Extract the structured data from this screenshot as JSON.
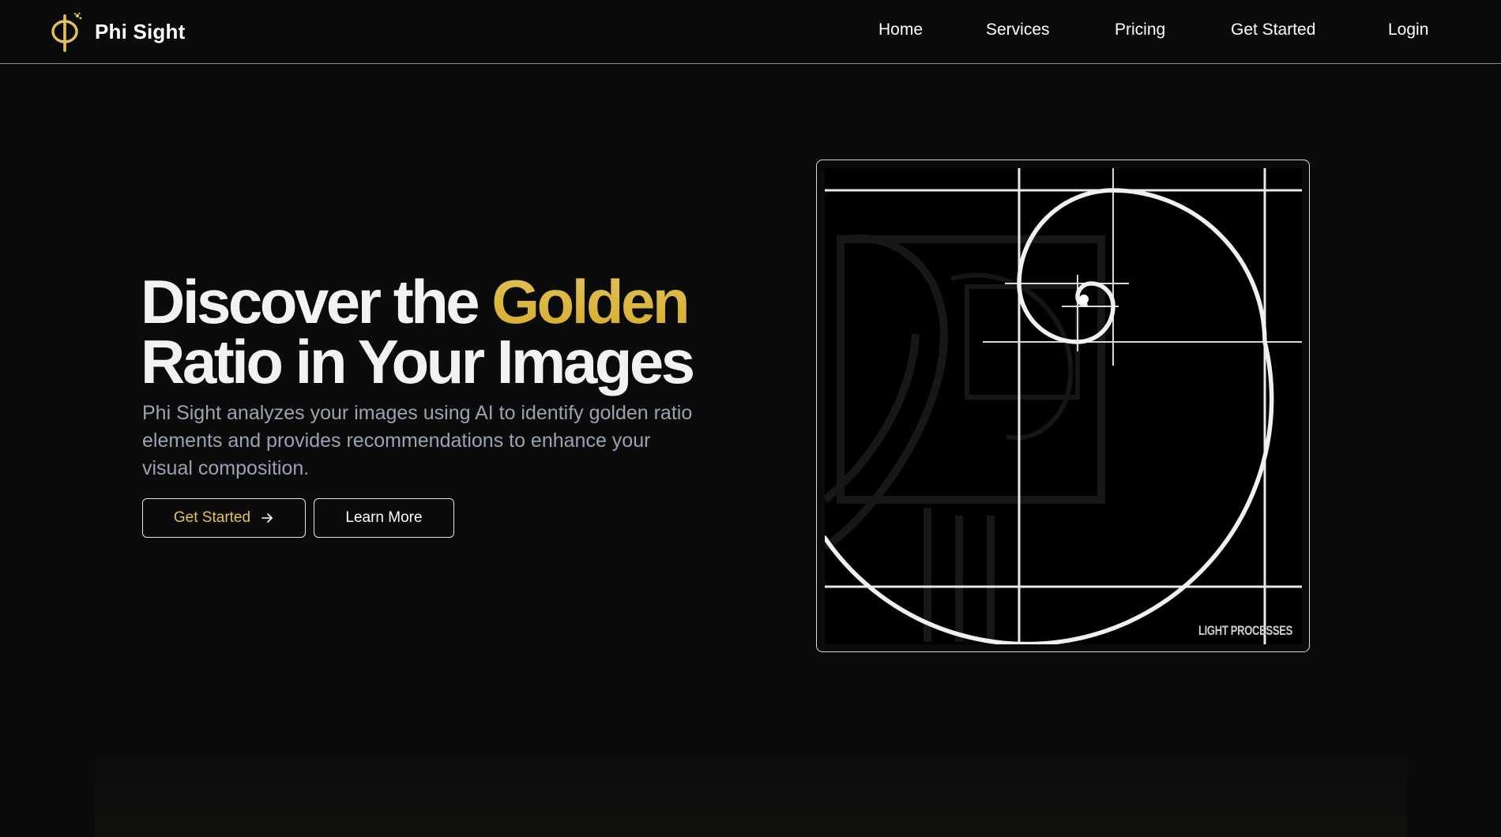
{
  "brand": {
    "name": "Phi Sight",
    "logo_icon": "phi-icon",
    "accent": "#E3C25A"
  },
  "nav": {
    "links": [
      "Home",
      "Services",
      "Pricing",
      "Get Started",
      "Login"
    ]
  },
  "hero": {
    "title_part1": "Discover the ",
    "title_highlight": "Golden",
    "title_line2": "Ratio in Your Images",
    "description": "Phi Sight analyzes your images using AI to identify golden ratio elements and provides recommendations to enhance your visual composition.",
    "primary_button": "Get Started",
    "secondary_button": "Learn More"
  },
  "image": {
    "watermark": "LIGHT PROCESSES",
    "subject": "golden spiral diagram"
  },
  "colors": {
    "background": "#0B0B0B",
    "gold": "#E3C25A",
    "muted_text": "#9AA3B2"
  }
}
